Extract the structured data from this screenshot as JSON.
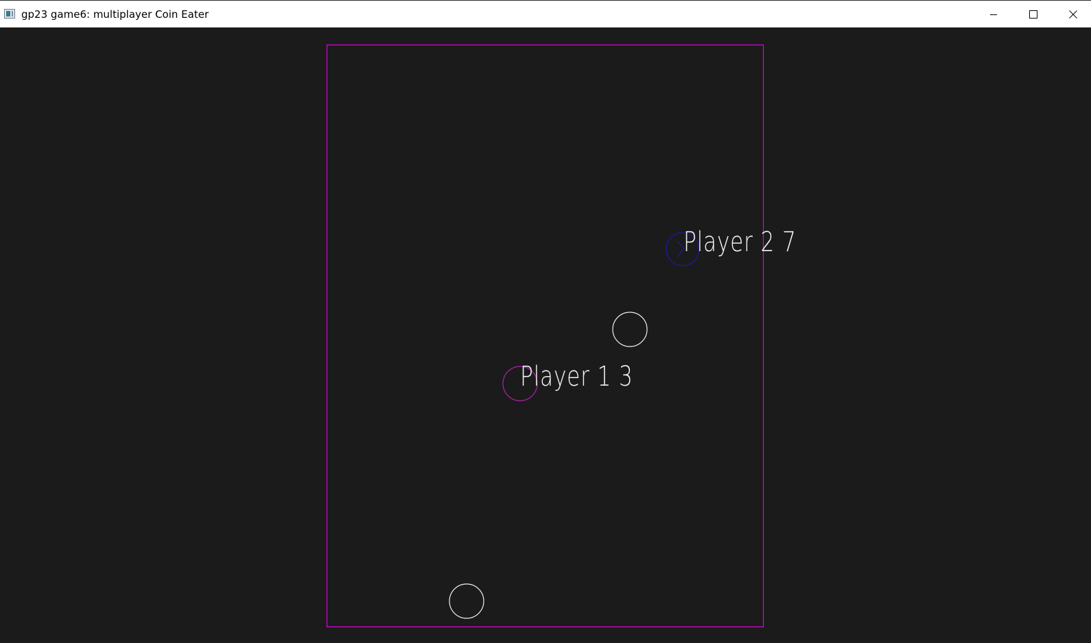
{
  "window": {
    "title": "gp23 game6: multiplayer Coin Eater",
    "icon": "app-window-icon",
    "controls": [
      "minimize-icon",
      "maximize-icon",
      "close-icon"
    ]
  },
  "game": {
    "arena_border_color": "#e000e0",
    "background_color": "#1b1b1b",
    "players": [
      {
        "label": "Player 1",
        "score": "3",
        "color": "#b020b0"
      },
      {
        "label": "Player 2",
        "score": "7",
        "color": "#1a1aa8"
      }
    ],
    "coins": [
      {
        "color": "#f0f0f0"
      },
      {
        "color": "#f0f0f0"
      }
    ]
  }
}
